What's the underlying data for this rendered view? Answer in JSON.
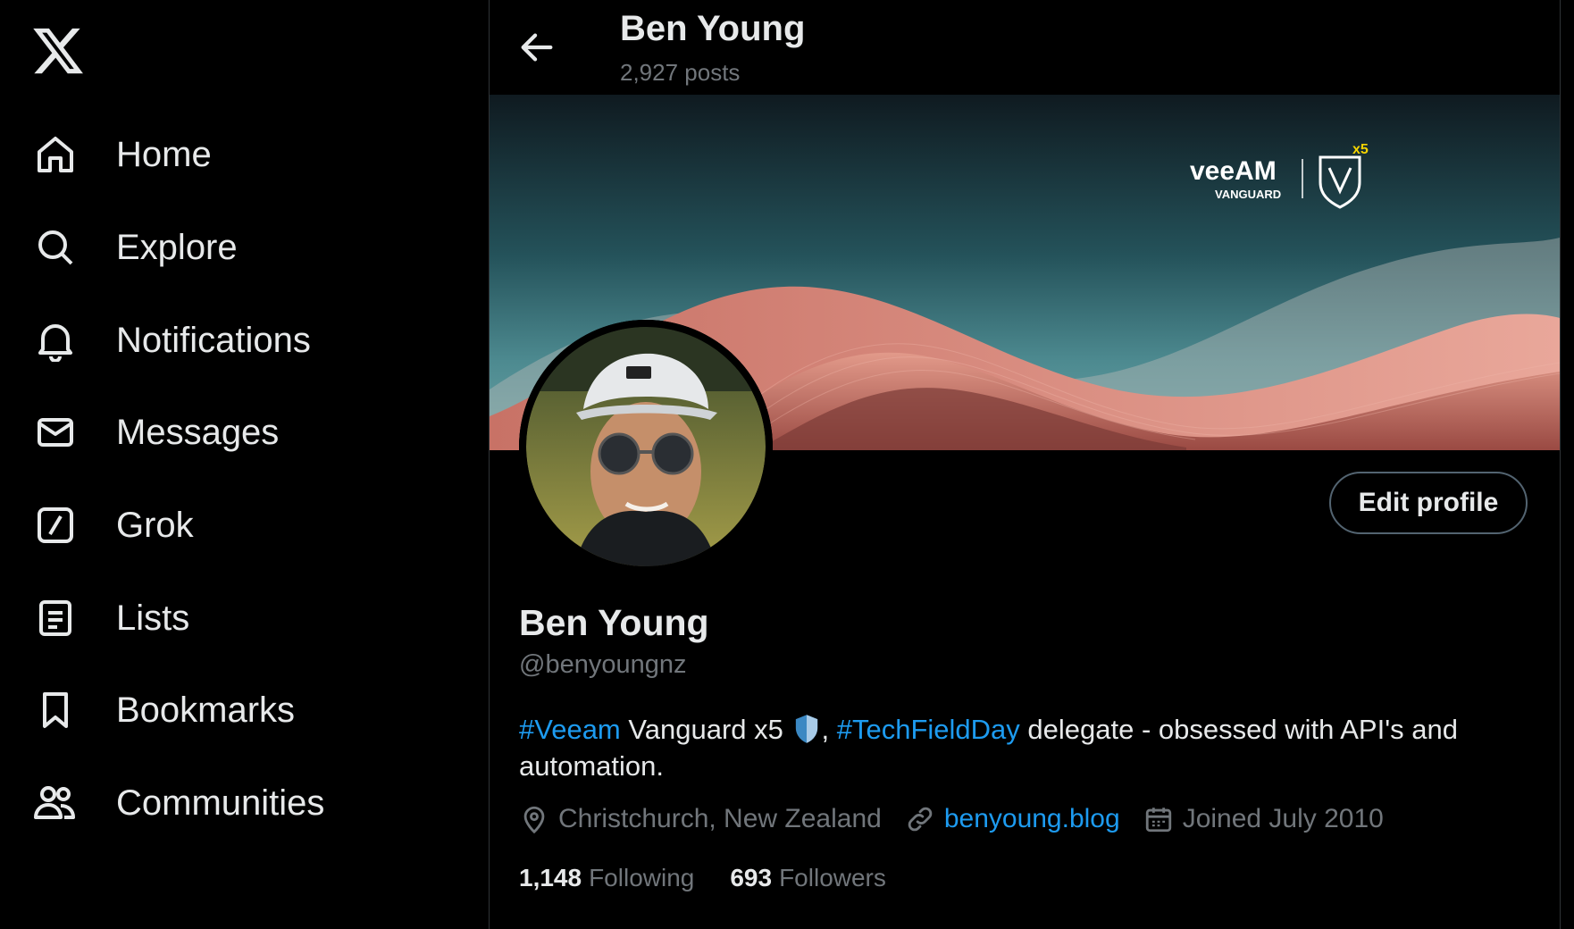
{
  "nav": {
    "items": [
      {
        "label": "Home",
        "icon": "home-icon"
      },
      {
        "label": "Explore",
        "icon": "search-icon"
      },
      {
        "label": "Notifications",
        "icon": "bell-icon"
      },
      {
        "label": "Messages",
        "icon": "mail-icon"
      },
      {
        "label": "Grok",
        "icon": "grok-icon"
      },
      {
        "label": "Lists",
        "icon": "list-icon"
      },
      {
        "label": "Bookmarks",
        "icon": "bookmark-icon"
      },
      {
        "label": "Communities",
        "icon": "communities-icon"
      }
    ]
  },
  "header": {
    "name": "Ben Young",
    "posts": "2,927 posts"
  },
  "banner": {
    "brand": "veeAM",
    "subtitle": "VANGUARD",
    "badge": "x5"
  },
  "profile": {
    "name": "Ben Young",
    "handle": "@benyoungnz",
    "edit_label": "Edit profile",
    "bio": {
      "tag1": "#Veeam",
      "text1": " Vanguard x5 ",
      "sep": ", ",
      "tag2": "#TechFieldDay",
      "text2": " delegate - obsessed with API's and automation."
    },
    "location": "Christchurch, New Zealand",
    "website": "benyoung.blog",
    "joined": "Joined July 2010",
    "following_count": "1,148",
    "following_label": "Following",
    "followers_count": "693",
    "followers_label": "Followers"
  },
  "colors": {
    "accent": "#1d9bf0",
    "muted": "#71767b",
    "text": "#e7e9ea",
    "background": "#000000"
  }
}
